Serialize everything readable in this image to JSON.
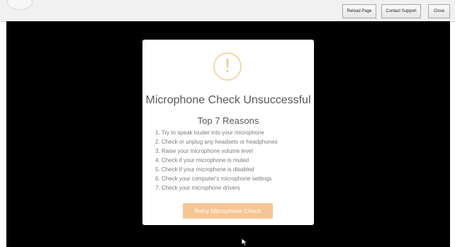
{
  "toolbar": {
    "reload_label": "Reload Page",
    "support_label": "Contact Support",
    "close_label": "Close"
  },
  "modal": {
    "icon": "warning-icon",
    "icon_glyph": "!",
    "title": "Microphone Check Unsuccessful",
    "subtitle": "Top 7 Reasons",
    "reasons": [
      "1.  Try to speak louder into your microphone",
      "2.  Check or unplug any headsets or headphones",
      "3.  Raise your microphone volume level",
      "4.  Check if your microphone is muted",
      "5.  Check if your microphone is disabled",
      "6.  Check your computer's microphone settings",
      "7.  Check your microphone drivers"
    ],
    "retry_label": "Retry Microphone Check"
  },
  "colors": {
    "accent": "#f6c594",
    "warning": "#f6c88e",
    "background": "#000000"
  }
}
